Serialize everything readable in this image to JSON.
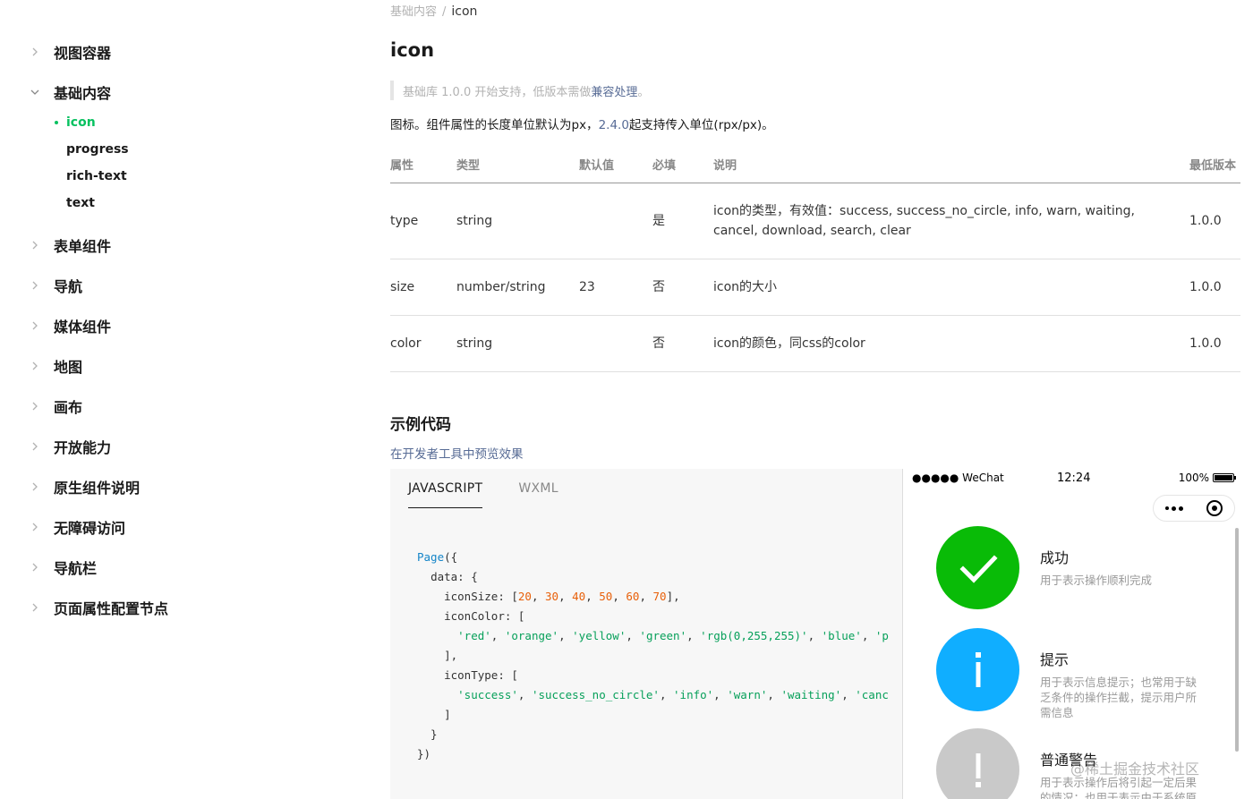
{
  "sidebar": {
    "items": [
      {
        "label": "视图容器"
      },
      {
        "label": "基础内容"
      },
      {
        "label": "表单组件"
      },
      {
        "label": "导航"
      },
      {
        "label": "媒体组件"
      },
      {
        "label": "地图"
      },
      {
        "label": "画布"
      },
      {
        "label": "开放能力"
      },
      {
        "label": "原生组件说明"
      },
      {
        "label": "无障碍访问"
      },
      {
        "label": "导航栏"
      },
      {
        "label": "页面属性配置节点"
      }
    ],
    "sub_items": [
      {
        "label": "icon",
        "active": true
      },
      {
        "label": "progress"
      },
      {
        "label": "rich-text"
      },
      {
        "label": "text"
      }
    ]
  },
  "breadcrumb": {
    "parent": "基础内容",
    "separator": "/",
    "current": "icon"
  },
  "page_title": "icon",
  "tip": {
    "prefix": "基础库 1.0.0 开始支持，低版本需做",
    "link": "兼容处理",
    "suffix": "。"
  },
  "description": {
    "prefix": "图标。组件属性的长度单位默认为px，",
    "link": "2.4.0",
    "suffix": "起支持传入单位(rpx/px)。"
  },
  "table": {
    "headers": [
      "属性",
      "类型",
      "默认值",
      "必填",
      "说明",
      "最低版本"
    ],
    "rows": [
      {
        "name": "type",
        "type": "string",
        "default": "",
        "required": "是",
        "desc": "icon的类型，有效值：success, success_no_circle, info, warn, waiting, cancel, download, search, clear",
        "version": "1.0.0"
      },
      {
        "name": "size",
        "type": "number/string",
        "default": "23",
        "required": "否",
        "desc": "icon的大小",
        "version": "1.0.0"
      },
      {
        "name": "color",
        "type": "string",
        "default": "",
        "required": "否",
        "desc": "icon的颜色，同css的color",
        "version": "1.0.0"
      }
    ]
  },
  "example": {
    "title": "示例代码",
    "preview_link": "在开发者工具中预览效果",
    "tabs": [
      "JAVASCRIPT",
      "WXML"
    ],
    "active_tab": "JAVASCRIPT"
  },
  "code": {
    "page": "Page",
    "data_key": "data",
    "iconSize_key": "iconSize",
    "iconSize": [
      "20",
      "30",
      "40",
      "50",
      "60",
      "70"
    ],
    "iconColor_key": "iconColor",
    "iconColor": [
      "'red'",
      "'orange'",
      "'yellow'",
      "'green'",
      "'rgb(0,255,255)'",
      "'blue'",
      "'p"
    ],
    "iconType_key": "iconType",
    "iconType": [
      "'success'",
      "'success_no_circle'",
      "'info'",
      "'warn'",
      "'waiting'",
      "'canc"
    ]
  },
  "phone": {
    "carrier": "●●●●● WeChat",
    "time": "12:24",
    "battery": "100%",
    "items": [
      {
        "title": "成功",
        "desc": "用于表示操作顺利完成",
        "color": "#09bb07"
      },
      {
        "title": "提示",
        "desc": "用于表示信息提示；也常用于缺乏条件的操作拦截，提示用户所需信息",
        "color": "#10aeff"
      },
      {
        "title": "普通警告",
        "desc": "用于表示操作后将引起一定后果的情况；也用于表示由于系统原因而造成的负向结果",
        "color": "#c9c9c9"
      }
    ]
  },
  "watermark": "@稀土掘金技术社区",
  "colors": {
    "accent": "#07c160",
    "link": "#576b95"
  }
}
